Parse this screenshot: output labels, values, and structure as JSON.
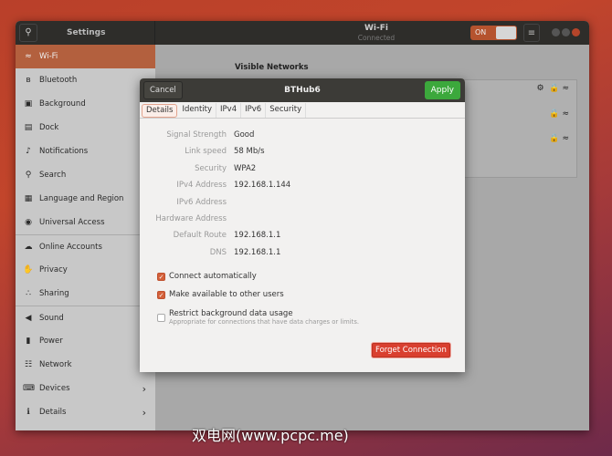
{
  "titlebar": {
    "app_title": "Settings",
    "panel_title": "Wi-Fi",
    "panel_subtitle": "Connected",
    "toggle_label": "ON"
  },
  "sidebar": {
    "items": [
      {
        "label": "Wi-Fi",
        "icon": "wifi-icon"
      },
      {
        "label": "Bluetooth",
        "icon": "bluetooth-icon"
      },
      {
        "label": "Background",
        "icon": "background-icon"
      },
      {
        "label": "Dock",
        "icon": "dock-icon"
      },
      {
        "label": "Notifications",
        "icon": "bell-icon"
      },
      {
        "label": "Search",
        "icon": "search-icon"
      },
      {
        "label": "Language and Region",
        "icon": "language-icon"
      },
      {
        "label": "Universal Access",
        "icon": "accessibility-icon"
      },
      {
        "label": "Online Accounts",
        "icon": "accounts-icon"
      },
      {
        "label": "Privacy",
        "icon": "privacy-icon"
      },
      {
        "label": "Sharing",
        "icon": "share-icon"
      },
      {
        "label": "Sound",
        "icon": "sound-icon"
      },
      {
        "label": "Power",
        "icon": "power-icon"
      },
      {
        "label": "Network",
        "icon": "network-icon"
      },
      {
        "label": "Devices",
        "icon": "devices-icon"
      },
      {
        "label": "Details",
        "icon": "details-icon"
      }
    ]
  },
  "main": {
    "visible_networks": "Visible Networks"
  },
  "dialog": {
    "cancel": "Cancel",
    "title": "BTHub6",
    "apply": "Apply",
    "tabs": [
      "Details",
      "Identity",
      "IPv4",
      "IPv6",
      "Security"
    ],
    "details": [
      {
        "k": "Signal Strength",
        "v": "Good"
      },
      {
        "k": "Link speed",
        "v": "58 Mb/s"
      },
      {
        "k": "Security",
        "v": "WPA2"
      },
      {
        "k": "IPv4 Address",
        "v": "192.168.1.144"
      },
      {
        "k": "IPv6 Address",
        "v": ""
      },
      {
        "k": "Hardware Address",
        "v": ""
      },
      {
        "k": "Default Route",
        "v": "192.168.1.1"
      },
      {
        "k": "DNS",
        "v": "192.168.1.1"
      }
    ],
    "connect_auto": "Connect automatically",
    "available_all": "Make available to other users",
    "restrict": "Restrict background data usage",
    "restrict_hint": "Appropriate for connections that have data charges or limits.",
    "forget": "Forget Connection"
  },
  "watermark": "双电网(www.pcpc.me)"
}
